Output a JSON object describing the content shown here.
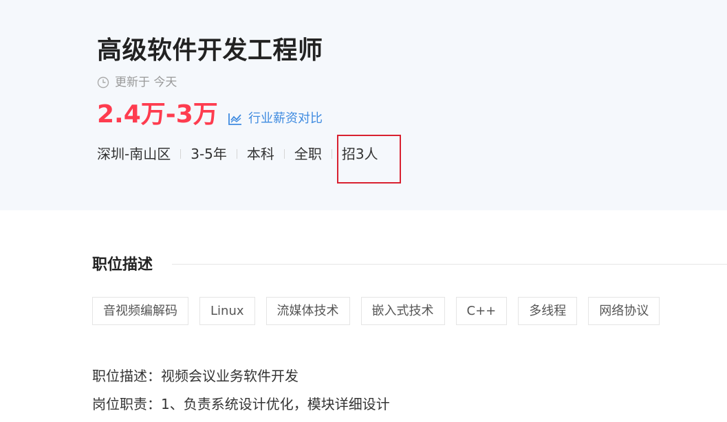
{
  "job": {
    "title": "高级软件开发工程师",
    "updated": "更新于 今天",
    "salary": "2.4万-3万",
    "compare_label": "行业薪资对比",
    "tags": [
      "深圳-南山区",
      "3-5年",
      "本科",
      "全职",
      "招3人"
    ]
  },
  "section": {
    "title": "职位描述",
    "skills": [
      "音视频编解码",
      "Linux",
      "流媒体技术",
      "嵌入式技术",
      "C++",
      "多线程",
      "网络协议"
    ],
    "lines": [
      "职位描述：视频会议业务软件开发",
      "岗位职责：1、负责系统设计优化，模块详细设计"
    ]
  },
  "colors": {
    "salary": "#fe3c4f",
    "link": "#3f8be0",
    "highlight": "#d8202f",
    "header_bg": "#f5f8fc"
  }
}
